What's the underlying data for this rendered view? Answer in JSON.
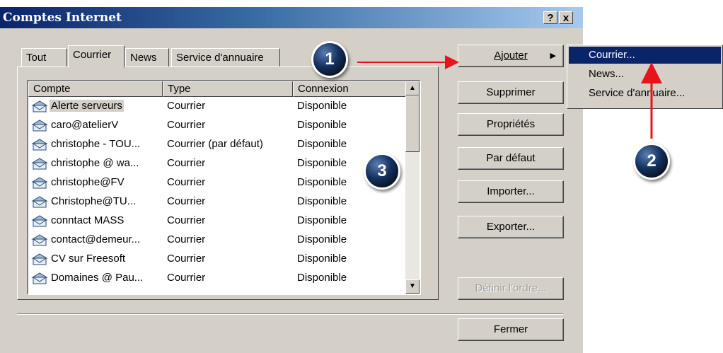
{
  "window": {
    "title": "Comptes Internet",
    "help_label": "?",
    "close_label": "x"
  },
  "tabs": [
    {
      "label": "Tout"
    },
    {
      "label": "Courrier"
    },
    {
      "label": "News"
    },
    {
      "label": "Service d'annuaire"
    }
  ],
  "list": {
    "columns": [
      "Compte",
      "Type",
      "Connexion"
    ],
    "rows": [
      {
        "account": "Alerte serveurs",
        "type": "Courrier",
        "connection": "Disponible"
      },
      {
        "account": "caro@atelierV",
        "type": "Courrier",
        "connection": "Disponible"
      },
      {
        "account": "christophe - TOU...",
        "type": "Courrier (par défaut)",
        "connection": "Disponible"
      },
      {
        "account": "christophe @ wa...",
        "type": "Courrier",
        "connection": "Disponible"
      },
      {
        "account": "christophe@FV",
        "type": "Courrier",
        "connection": "Disponible"
      },
      {
        "account": "Christophe@TU...",
        "type": "Courrier",
        "connection": "Disponible"
      },
      {
        "account": "conntact MASS",
        "type": "Courrier",
        "connection": "Disponible"
      },
      {
        "account": "contact@demeur...",
        "type": "Courrier",
        "connection": "Disponible"
      },
      {
        "account": "CV sur Freesoft",
        "type": "Courrier",
        "connection": "Disponible"
      },
      {
        "account": "Domaines @ Pau...",
        "type": "Courrier",
        "connection": "Disponible"
      }
    ]
  },
  "buttons": {
    "add": "Ajouter",
    "remove": "Supprimer",
    "properties": "Propriétés",
    "default": "Par défaut",
    "import": "Importer...",
    "export": "Exporter...",
    "order": "Définir l'ordre...",
    "close": "Fermer"
  },
  "menu": {
    "items": [
      "Courrier...",
      "News...",
      "Service d'annuaire..."
    ]
  },
  "annotations": {
    "badge1": "1",
    "badge2": "2",
    "badge3": "3"
  },
  "colors": {
    "selection": "#0a246a",
    "arrow": "#e8141c",
    "dialog": "#d4d0c8"
  }
}
